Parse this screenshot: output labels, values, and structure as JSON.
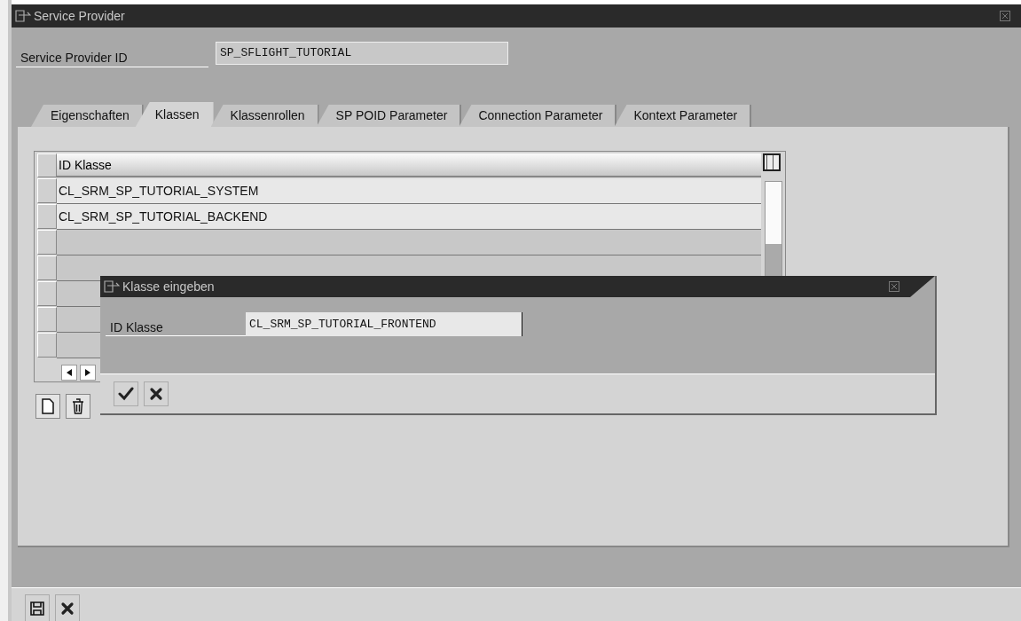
{
  "window": {
    "title": "Service Provider"
  },
  "header_field": {
    "label": "Service Provider ID",
    "value": "SP_SFLIGHT_TUTORIAL"
  },
  "tabs": [
    {
      "label": "Eigenschaften",
      "selected": false
    },
    {
      "label": "Klassen",
      "selected": true
    },
    {
      "label": "Klassenrollen",
      "selected": false
    },
    {
      "label": "SP POID Parameter",
      "selected": false
    },
    {
      "label": "Connection Parameter",
      "selected": false
    },
    {
      "label": "Kontext Parameter",
      "selected": false
    }
  ],
  "table": {
    "columns": [
      "ID Klasse"
    ],
    "rows": [
      {
        "cells": [
          "CL_SRM_SP_TUTORIAL_SYSTEM"
        ]
      },
      {
        "cells": [
          "CL_SRM_SP_TUTORIAL_BACKEND"
        ]
      }
    ]
  },
  "dialog": {
    "title": "Klasse eingeben",
    "field_label": "ID Klasse",
    "field_value": "CL_SRM_SP_TUTORIAL_FRONTEND"
  }
}
